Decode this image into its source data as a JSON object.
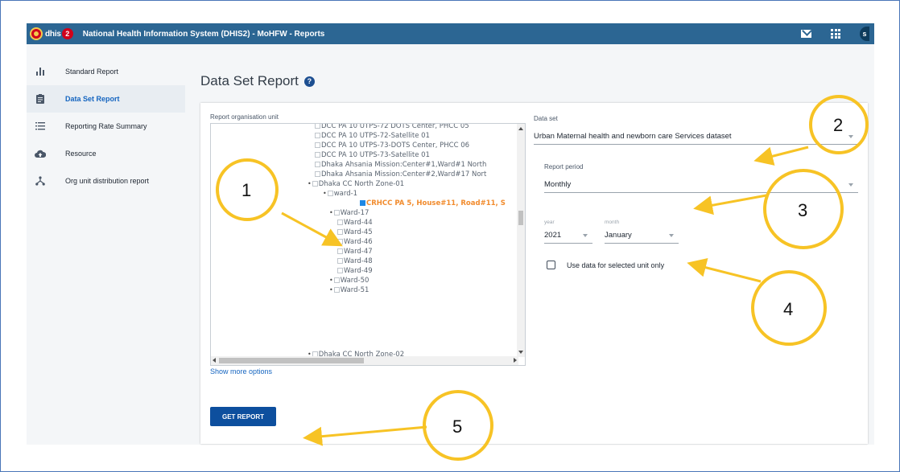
{
  "header": {
    "logo_text": "dhis",
    "logo_badge": "2",
    "app_title": "National Health Information System (DHIS2) - MoHFW - Reports",
    "avatar_initial": "s"
  },
  "sidebar": {
    "items": [
      {
        "label": "Standard Report",
        "icon": "bar-chart-icon"
      },
      {
        "label": "Data Set Report",
        "icon": "clipboard-icon",
        "active": true
      },
      {
        "label": "Reporting Rate Summary",
        "icon": "list-icon"
      },
      {
        "label": "Resource",
        "icon": "cloud-icon"
      },
      {
        "label": "Org unit distribution report",
        "icon": "hierarchy-icon"
      }
    ]
  },
  "page": {
    "title": "Data Set Report",
    "help_icon": "?"
  },
  "org_unit": {
    "label": "Report organisation unit",
    "tree": [
      {
        "text": "DCC PA 10 UTPS-72 DOTS Center, PHCC 05",
        "level": 3
      },
      {
        "text": "DCC PA 10 UTPS-72-Satellite 01",
        "level": 3
      },
      {
        "text": "DCC PA 10 UTPS-73-DOTS Center, PHCC 06",
        "level": 3
      },
      {
        "text": "DCC PA 10 UTPS-73-Satellite 01",
        "level": 3
      },
      {
        "text": "Dhaka Ahsania Mission:Center#1,Ward#1 North",
        "level": 3
      },
      {
        "text": "Dhaka Ahsania Mission:Center#2,Ward#17 Nort",
        "level": 3
      },
      {
        "text": "Dhaka CC North Zone-01",
        "level": 2,
        "expandable": true
      },
      {
        "text": "ward-1",
        "level": 3,
        "expandable": true
      },
      {
        "text": "CRHCC PA 5, House#11, Road#11, S",
        "level": 5,
        "selected": true
      },
      {
        "text": "Ward-17",
        "level": 4,
        "expandable": true
      },
      {
        "text": "Ward-44",
        "level": 4
      },
      {
        "text": "Ward-45",
        "level": 4
      },
      {
        "text": "Ward-46",
        "level": 4
      },
      {
        "text": "Ward-47",
        "level": 4
      },
      {
        "text": "Ward-48",
        "level": 4
      },
      {
        "text": "Ward-49",
        "level": 4
      },
      {
        "text": "Ward-50",
        "level": 4,
        "expandable": true
      },
      {
        "text": "Ward-51",
        "level": 4,
        "expandable": true
      },
      {
        "text": "Dhaka CC North Zone-02",
        "level": 2,
        "expandable": true
      }
    ],
    "show_more": "Show more options"
  },
  "form": {
    "dataset_label": "Data set",
    "dataset_value": "Urban Maternal health and newborn care Services dataset",
    "period_label": "Report period",
    "period_value": "Monthly",
    "year_label": "year",
    "year_value": "2021",
    "month_label": "month",
    "month_value": "January",
    "selected_unit_label": "Use data for selected unit only",
    "get_report": "GET REPORT"
  },
  "annotations": {
    "callouts": [
      "1",
      "2",
      "3",
      "4",
      "5"
    ],
    "color": "#f7c325"
  },
  "colors": {
    "header": "#2c6693",
    "primary_button": "#0d4f9e",
    "selected_text": "#f18b2d",
    "link": "#1565c0"
  }
}
